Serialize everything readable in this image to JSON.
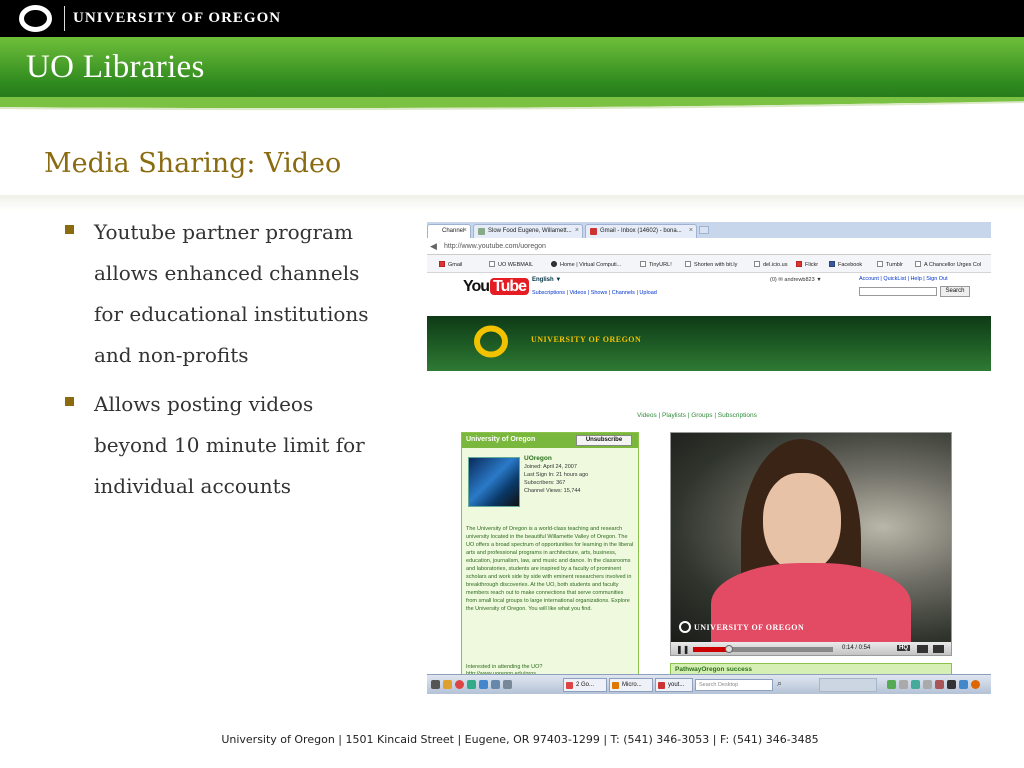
{
  "header": {
    "university_name": "UNIVERSITY OF OREGON",
    "libraries_title": "UO Libraries"
  },
  "slide": {
    "title": "Media Sharing: Video",
    "bullets": [
      "Youtube partner program allows enhanced channels for educational institutions and non-profits",
      "Allows posting videos beyond 10 minute limit for individual accounts"
    ]
  },
  "screenshot": {
    "tabs": [
      {
        "label": "Channel",
        "active": true
      },
      {
        "label": "Slow Food Eugene, Willamett...",
        "active": false
      },
      {
        "label": "Gmail - Inbox (14602) - bona...",
        "active": false
      }
    ],
    "url": "http://www.youtube.com/uoregon",
    "bookmarks": [
      "Gmail",
      "UO WEBMAIL",
      "Home | Virtual Computi...",
      "TinyURL!",
      "Shorten with bit.ly",
      "del.icio.us",
      "Flickr",
      "Facebook",
      "Tumblr",
      "A Chancellor Urges Col"
    ],
    "youtube": {
      "logo_you": "You",
      "logo_tube": "Tube",
      "language": "English ▼",
      "links": "Subscriptions | Videos | Shows | Channels | Upload",
      "user": "(0) ✉ andrewb823 ▼",
      "account_links": "Account | QuickList | Help | Sign Out",
      "search_button": "Search"
    },
    "channel_banner": "UNIVERSITY OF OREGON",
    "channel_nav": "Videos  |  Playlists  |  Groups  |  Subscriptions",
    "channel_box": {
      "name": "University of Oregon",
      "unsubscribe": "Unsubscribe",
      "username": "UOregon",
      "joined": "Joined: April 24, 2007",
      "last_sign_in": "Last Sign In: 21 hours ago",
      "subscribers": "Subscribers: 367",
      "channel_views": "Channel Views: 15,744",
      "description": "The University of Oregon is a world-class teaching and research university located in the beautiful Willamette Valley of Oregon. The UO offers a broad spectrum of opportunities for learning in the liberal arts and professional programs in architecture, arts, business, education, journalism, law, and music and dance. In the classrooms and laboratories, students are inspired by a faculty of prominent scholars and work side by side with eminent researchers involved in breakthrough discoveries. At the UO, both students and faculty members reach out to make connections that serve communities from small local groups to large international organizations. Explore the University of Oregon. You will like what you find.",
      "question": "Interested in attending the UO?",
      "question_link": "http://www.uoregon.edu/pros..."
    },
    "player": {
      "watermark": "UNIVERSITY OF OREGON",
      "time": "0:14 / 0:54",
      "hq": "HQ",
      "progress_fraction": 0.26,
      "video_title": "PathwayOregon success"
    },
    "taskbar": {
      "buttons": [
        "2 Go...",
        "Micro...",
        "yout..."
      ],
      "search_placeholder": "Search Desktop"
    }
  },
  "footer": "University of Oregon | 1501 Kincaid Street | Eugene, OR 97403-1299 | T: (541) 346-3053 | F: (541) 346-3485",
  "colors": {
    "uo_green": "#2f8a1e",
    "uo_gold": "#8a6b10",
    "youtube_red": "#e51c23",
    "channel_green": "#79b83c"
  }
}
